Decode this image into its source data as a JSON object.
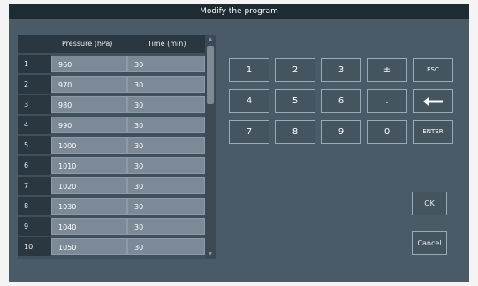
{
  "window": {
    "title": "Modify the program"
  },
  "table": {
    "headers": {
      "pressure": "Pressure (hPa)",
      "time": "Time (min)"
    },
    "rows": [
      {
        "num": "1",
        "pressure": "960",
        "time": "30"
      },
      {
        "num": "2",
        "pressure": "970",
        "time": "30"
      },
      {
        "num": "3",
        "pressure": "980",
        "time": "30"
      },
      {
        "num": "4",
        "pressure": "990",
        "time": "30"
      },
      {
        "num": "5",
        "pressure": "1000",
        "time": "30"
      },
      {
        "num": "6",
        "pressure": "1010",
        "time": "30"
      },
      {
        "num": "7",
        "pressure": "1020",
        "time": "30"
      },
      {
        "num": "8",
        "pressure": "1030",
        "time": "30"
      },
      {
        "num": "9",
        "pressure": "1040",
        "time": "30"
      },
      {
        "num": "10",
        "pressure": "1050",
        "time": "30"
      }
    ]
  },
  "keypad": {
    "k1": "1",
    "k2": "2",
    "k3": "3",
    "plusminus": "±",
    "esc": "ESC",
    "k4": "4",
    "k5": "5",
    "k6": "6",
    "dot": ".",
    "k7": "7",
    "k8": "8",
    "k9": "9",
    "k0": "0",
    "enter": "ENTER"
  },
  "actions": {
    "ok": "OK",
    "cancel": "Cancel"
  },
  "colors": {
    "background": "#4a5a66",
    "titlebar": "#1f2b33",
    "cell": "#7b8a96"
  }
}
